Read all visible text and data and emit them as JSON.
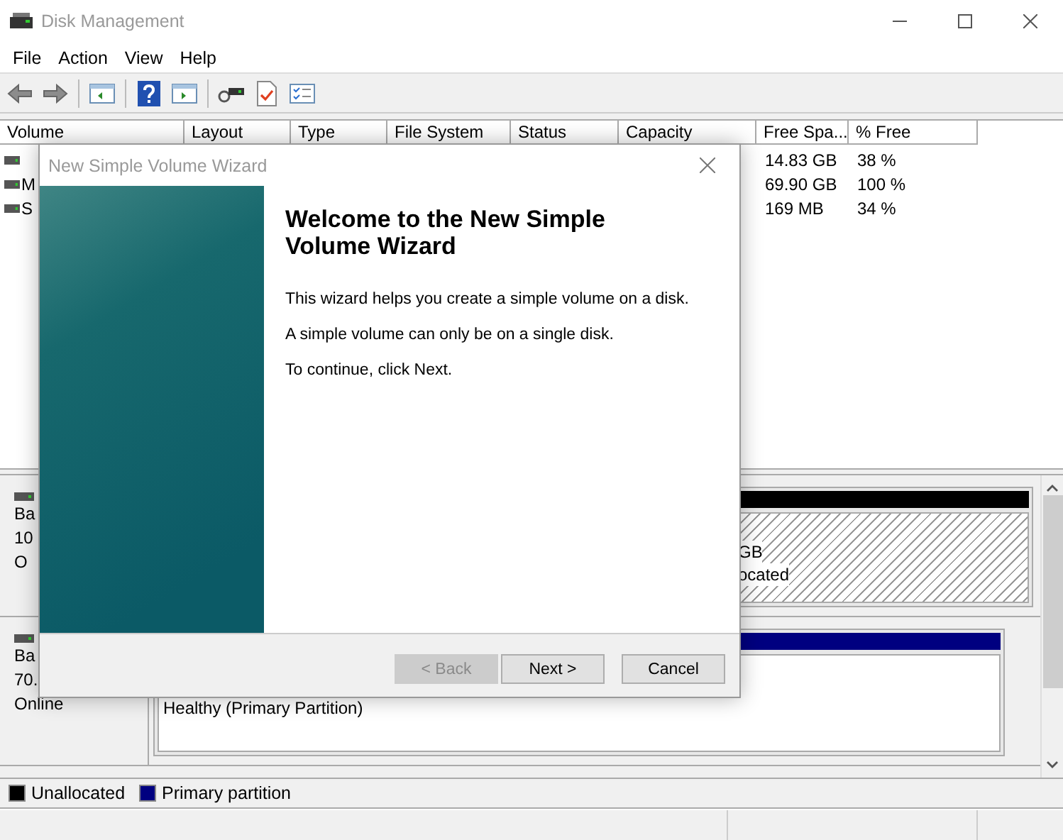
{
  "window": {
    "title": "Disk Management"
  },
  "menu": [
    "File",
    "Action",
    "View",
    "Help"
  ],
  "volume_table": {
    "columns": [
      "Volume",
      "Layout",
      "Type",
      "File System",
      "Status",
      "Capacity",
      "Free Spa...",
      "% Free"
    ],
    "rows": [
      {
        "free_space": "14.83 GB",
        "percent_free": "38 %"
      },
      {
        "volume": "M",
        "free_space": "69.90 GB",
        "percent_free": "100 %"
      },
      {
        "volume": "S",
        "free_space": "169 MB",
        "percent_free": "34 %"
      }
    ]
  },
  "disks": [
    {
      "label_lines": [
        "Ba",
        "10",
        "O"
      ],
      "partitions": [
        {
          "kind": "unallocated",
          "lines": [
            "GB",
            "ocated"
          ]
        }
      ]
    },
    {
      "label_lines": [
        "Ba",
        "70.",
        "Online"
      ],
      "partitions": [
        {
          "kind": "primary",
          "lines": [
            "Healthy (Primary Partition)"
          ]
        }
      ]
    }
  ],
  "legend": [
    {
      "label": "Unallocated",
      "color": "#000000"
    },
    {
      "label": "Primary partition",
      "color": "#000080"
    }
  ],
  "dialog": {
    "title": "New Simple Volume Wizard",
    "heading": "Welcome to the New Simple Volume Wizard",
    "paragraphs": [
      "This wizard helps you create a simple volume on a disk.",
      "A simple volume can only be on a single disk.",
      "To continue, click Next."
    ],
    "buttons": [
      {
        "label": "< Back",
        "disabled": true
      },
      {
        "label": "Next >",
        "disabled": false
      },
      {
        "label": "Cancel",
        "disabled": false
      }
    ]
  }
}
